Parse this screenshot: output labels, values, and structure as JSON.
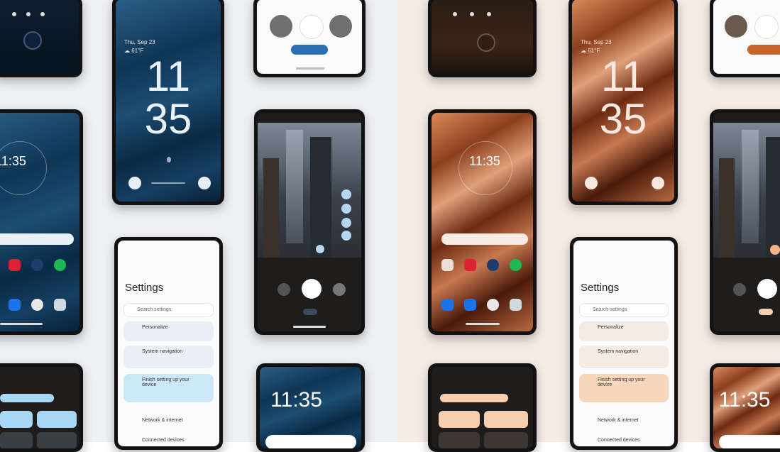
{
  "clock": {
    "hour": "11",
    "minute": "35",
    "small": "11:35"
  },
  "settings": {
    "title": "Settings",
    "search_placeholder": "Search settings",
    "items": [
      {
        "label": "Personalize"
      },
      {
        "label": "System navigation"
      },
      {
        "label": "Finish setting up your device"
      },
      {
        "label": "Network & internet"
      },
      {
        "label": "Connected devices"
      }
    ]
  },
  "camera": {
    "mode_selected": "Photo"
  },
  "colors": {
    "bg_left": "#eef0f3",
    "bg_right": "#f7ebe5",
    "accent_blue": "#a8d8f5",
    "accent_peach": "#f7cfae"
  }
}
